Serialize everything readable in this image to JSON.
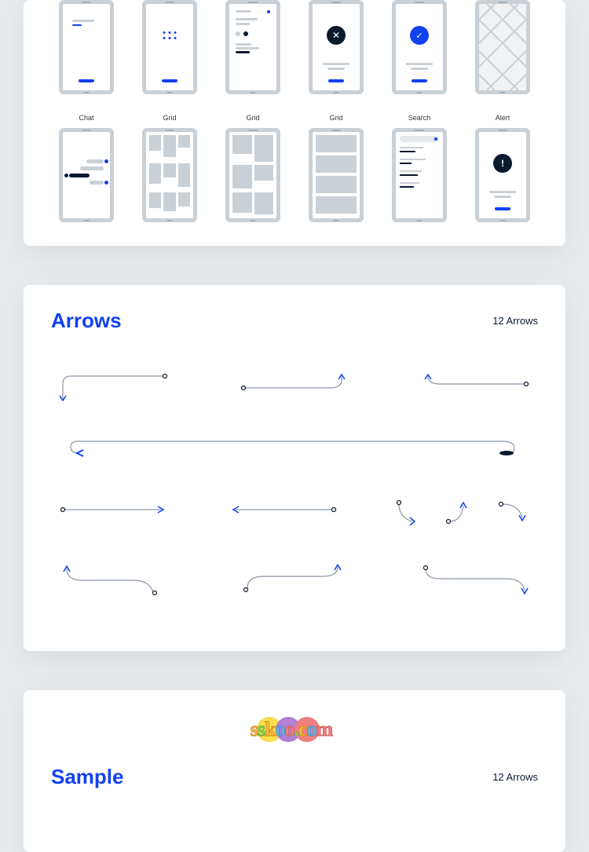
{
  "row1_labels": [
    "",
    "",
    "",
    "",
    "",
    ""
  ],
  "row2_labels": [
    "Chat",
    "Grid",
    "Grid",
    "Grid",
    "Search",
    "Alert"
  ],
  "arrows_card": {
    "title": "Arrows",
    "subtitle": "12 Arrows"
  },
  "sample_card": {
    "title": "Sample",
    "subtitle": "12 Arrows"
  },
  "watermark_text": "sskoo.com",
  "colors": {
    "primary": "#1241f2",
    "dark": "#0a1a2f",
    "gray": "#c9d0d6"
  }
}
